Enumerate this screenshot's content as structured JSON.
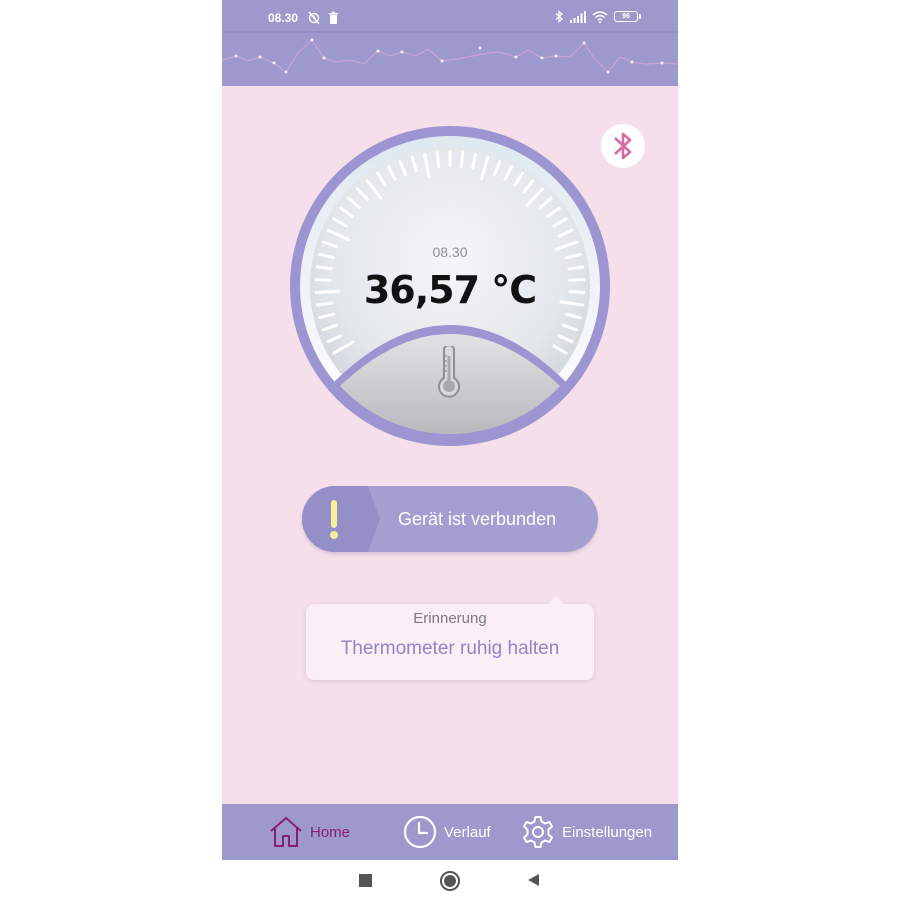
{
  "status_bar": {
    "time": "08.30",
    "battery": "96",
    "icons": [
      "alarm-off-icon",
      "trash-icon",
      "bluetooth-icon",
      "signal-icon",
      "wifi-icon",
      "battery-icon"
    ]
  },
  "gauge": {
    "time": "08.30",
    "temperature": "36,57 °C",
    "icon": "thermometer-icon"
  },
  "device_status": {
    "label": "Gerät ist verbunden",
    "icon": "exclamation-icon"
  },
  "reminder": {
    "title": "Erinnerung",
    "text": "Thermometer ruhig halten"
  },
  "bottom_nav": {
    "items": [
      {
        "label": "Home",
        "icon": "home-icon",
        "active": true
      },
      {
        "label": "Verlauf",
        "icon": "clock-icon",
        "active": false
      },
      {
        "label": "Einstellungen",
        "icon": "gear-icon",
        "active": false
      }
    ]
  },
  "colors": {
    "header": "#9d99cc",
    "background": "#f4dfea",
    "accent_active": "#8a1d73",
    "bluetooth": "#d46aa5",
    "gauge_ring": "#9d95d1"
  }
}
